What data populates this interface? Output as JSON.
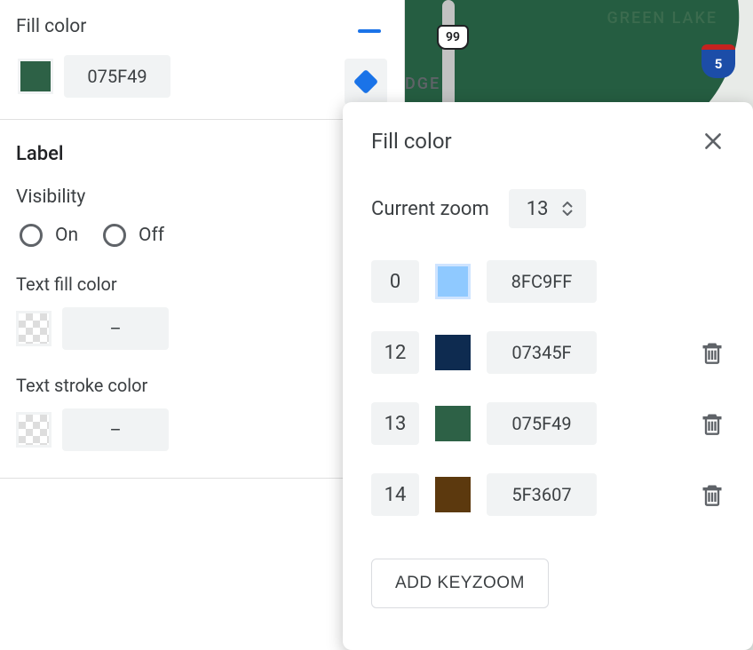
{
  "sidebar": {
    "fill_color_label": "Fill color",
    "fill_color_swatch": "#2d6146",
    "fill_color_hex": "075F49",
    "label_heading": "Label",
    "visibility_label": "Visibility",
    "visibility_options": {
      "on": "On",
      "off": "Off"
    },
    "text_fill_label": "Text fill color",
    "text_fill_hex": "–",
    "text_stroke_label": "Text stroke color",
    "text_stroke_hex": "–"
  },
  "map": {
    "shield_99": "99",
    "green_lake": "GREEN LAKE",
    "edge": "DGE",
    "i5": "5"
  },
  "popup": {
    "title": "Fill color",
    "zoom_label": "Current zoom",
    "zoom_value": "13",
    "keyzooms": [
      {
        "level": "0",
        "swatch": "#8fc9ff",
        "hex": "8FC9FF",
        "border": true,
        "deletable": false
      },
      {
        "level": "12",
        "swatch": "#0e2b50",
        "hex": "07345F",
        "border": false,
        "deletable": true
      },
      {
        "level": "13",
        "swatch": "#2d6146",
        "hex": "075F49",
        "border": false,
        "deletable": true
      },
      {
        "level": "14",
        "swatch": "#5c390e",
        "hex": "5F3607",
        "border": false,
        "deletable": true
      }
    ],
    "add_label": "ADD KEYZOOM"
  }
}
